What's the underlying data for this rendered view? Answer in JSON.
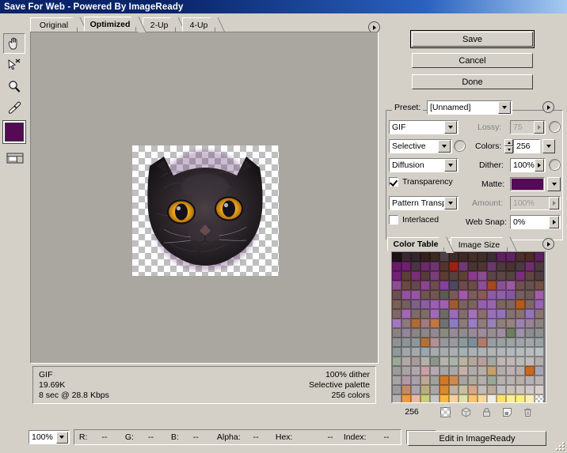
{
  "window": {
    "title": "Save For Web - Powered By ImageReady"
  },
  "tabs": [
    {
      "label": "Original",
      "active": false
    },
    {
      "label": "Optimized",
      "active": true
    },
    {
      "label": "2-Up",
      "active": false
    },
    {
      "label": "4-Up",
      "active": false
    }
  ],
  "toolbar": {
    "tools": [
      {
        "name": "hand-tool",
        "selected": true
      },
      {
        "name": "slice-select-tool",
        "selected": false
      },
      {
        "name": "zoom-tool",
        "selected": false
      },
      {
        "name": "eyedropper-tool",
        "selected": false
      }
    ],
    "eyedropper_color": "#550a55",
    "toggle_slices_name": "toggle-slices-visibility"
  },
  "buttons": {
    "save": "Save",
    "cancel": "Cancel",
    "done": "Done",
    "edit_in_imageready": "Edit in ImageReady"
  },
  "settings": {
    "preset_label": "Preset:",
    "preset_value": "[Unnamed]",
    "format_value": "GIF",
    "reduction_value": "Selective",
    "dither_algorithm_value": "Diffusion",
    "transparency_label": "Transparency",
    "transparency_checked": true,
    "transparency_dither_value": "Pattern Transp..",
    "interlaced_label": "Interlaced",
    "interlaced_checked": false,
    "lossy_label": "Lossy:",
    "lossy_value": "75",
    "lossy_enabled": false,
    "colors_label": "Colors:",
    "colors_value": "256",
    "dither_label": "Dither:",
    "dither_value": "100%",
    "matte_label": "Matte:",
    "matte_color": "#550a55",
    "amount_label": "Amount:",
    "amount_value": "100%",
    "amount_enabled": false,
    "web_snap_label": "Web Snap:",
    "web_snap_value": "0%"
  },
  "info": {
    "format": "GIF",
    "filesize": "19.69K",
    "download_time": "8 sec @ 28.8 Kbps",
    "dither": "100% dither",
    "palette": "Selective palette",
    "colors": "256 colors"
  },
  "color_table": {
    "tabs": [
      {
        "label": "Color Table",
        "active": true
      },
      {
        "label": "Image Size",
        "active": false
      }
    ],
    "count": "256",
    "buttons": [
      {
        "name": "map-to-transparent-button"
      },
      {
        "name": "web-shift-button"
      },
      {
        "name": "lock-color-button"
      },
      {
        "name": "new-color-button"
      },
      {
        "name": "delete-color-button"
      }
    ],
    "swatches": [
      "#1d1118",
      "#3a2830",
      "#33252c",
      "#36201c",
      "#3c2a23",
      "#4d4048",
      "#402a27",
      "#3e2a25",
      "#432e29",
      "#3f2d2a",
      "#3a2d35",
      "#602060",
      "#612262",
      "#4a2e2b",
      "#4c2a26",
      "#5e2060",
      "#6b1a6b",
      "#6f1f6f",
      "#4a3640",
      "#6a2b6a",
      "#6e3570",
      "#54342f",
      "#9a2410",
      "#6f3a70",
      "#4a342f",
      "#4f3731",
      "#6a3a6a",
      "#4b393d",
      "#483232",
      "#4c3a42",
      "#722c72",
      "#4e3a3e",
      "#741f74",
      "#5b3f36",
      "#7a2d7a",
      "#563c38",
      "#7a3e7c",
      "#5a3c33",
      "#57403d",
      "#5f4136",
      "#8a3a8c",
      "#8a4d8e",
      "#5a4444",
      "#5e4347",
      "#56423e",
      "#7a2e7a",
      "#624440",
      "#4d3c42",
      "#8e4d92",
      "#6a4a40",
      "#64484a",
      "#8b4591",
      "#6c4e4e",
      "#84409a",
      "#4d4a5e",
      "#6e4a4e",
      "#6c4c44",
      "#8d4e95",
      "#a14a1e",
      "#8b5293",
      "#9a5a9e",
      "#6e5050",
      "#655250",
      "#725044",
      "#6b5050",
      "#9352a1",
      "#9456a3",
      "#705452",
      "#74564e",
      "#5d5a52",
      "#7a5a58",
      "#a259ad",
      "#7d5c5c",
      "#8a5a56",
      "#8a5ca4",
      "#8e5fa8",
      "#8258a0",
      "#755e5c",
      "#6e5c5a",
      "#a05ea8",
      "#7a5e58",
      "#765e5e",
      "#80608a",
      "#8a5ea0",
      "#9a5fae",
      "#a05fb0",
      "#a05a32",
      "#7b6260",
      "#7e6260",
      "#9460ac",
      "#9a64b0",
      "#7c6462",
      "#7e6662",
      "#b35a1c",
      "#806666",
      "#9664b2",
      "#7e6866",
      "#a268b4",
      "#806a66",
      "#7e6c68",
      "#a16ab6",
      "#6e6a66",
      "#9c6cb8",
      "#816e6c",
      "#a470ba",
      "#8a6e6a",
      "#9b70b8",
      "#9372ba",
      "#847270",
      "#8a726e",
      "#9474bc",
      "#8a7472",
      "#a376bc",
      "#8a7a7c",
      "#b06a3a",
      "#a07a80",
      "#c07840",
      "#6f7270",
      "#8e7cc0",
      "#8a7a78",
      "#9a7ec4",
      "#8e7c7a",
      "#9a80b8",
      "#8e8078",
      "#97827e",
      "#9a82b0",
      "#9a8296",
      "#8e8280",
      "#8a8280",
      "#92849a",
      "#8a8482",
      "#8e8686",
      "#928890",
      "#8a8a80",
      "#968a94",
      "#8e8c8c",
      "#9a8a96",
      "#9e8c9c",
      "#968e90",
      "#a08ea0",
      "#6e7d5e",
      "#9e90a6",
      "#8a8e8e",
      "#8e9092",
      "#909292",
      "#8e9494",
      "#8e9696",
      "#b4703a",
      "#b09296",
      "#96989a",
      "#9a9a9c",
      "#8a9a9a",
      "#7d8e9a",
      "#b47a6a",
      "#9a9ea0",
      "#9aa0a2",
      "#9ea2a4",
      "#a0a4a6",
      "#a4a6a8",
      "#9aa4a6",
      "#8e9a98",
      "#a2a6a8",
      "#a4a8aa",
      "#9aa6b0",
      "#a6aaac",
      "#a8acae",
      "#aaaeb0",
      "#a4b0b2",
      "#acb0b2",
      "#aeb2b4",
      "#b0b4b6",
      "#b2b6b8",
      "#b4b8ba",
      "#b6babc",
      "#b8bcbe",
      "#babfc0",
      "#9aa89a",
      "#b2aaa8",
      "#a89a9a",
      "#b4b0aa",
      "#8a968a",
      "#b6b2ac",
      "#aab4a8",
      "#bcb2a0",
      "#b2a89a",
      "#b69e9a",
      "#a2a8a4",
      "#beb6b2",
      "#c0b8b4",
      "#b8bab6",
      "#c2bab8",
      "#b4aeac",
      "#9c9a9a",
      "#a8a4a4",
      "#b0a6b0",
      "#c6a0a6",
      "#b8a8b0",
      "#a6a6a8",
      "#aaa8aa",
      "#c6b0aa",
      "#b0aaac",
      "#b6aea8",
      "#c8a06a",
      "#b2acae",
      "#bcb0b2",
      "#b4aeb0",
      "#c86a20",
      "#a4a6b6",
      "#a8a4a2",
      "#b09aa8",
      "#a8a2a8",
      "#bca894",
      "#a0a09e",
      "#ce7a2a",
      "#cf8a52",
      "#a8a2a0",
      "#b0aa9a",
      "#b4aeaa",
      "#9aa69a",
      "#b6b0ae",
      "#b8b2b0",
      "#baaea8",
      "#b6b0b2",
      "#bab4b6",
      "#9c9a9c",
      "#c48a62",
      "#aaa4ac",
      "#b8ae80",
      "#aaa6a8",
      "#d88a32",
      "#c0b2a0",
      "#c4c0a0",
      "#d8a68a",
      "#c2bcb4",
      "#baa898",
      "#c0bec2",
      "#cac0ba",
      "#cec4be",
      "#d0c8c4",
      "#d6d0cc",
      "#b4b2b4",
      "#ee9a3a",
      "#eab8a0",
      "#c9ce78",
      "#c6c6c8",
      "#fab83a",
      "#f8cfa0",
      "#dce2a8",
      "#f9c46e",
      "#fad79a",
      "#eeeee6",
      "#ffe06a",
      "#fbee96",
      "#ffef78",
      "#feeeb8",
      "#ffffff"
    ]
  },
  "status": {
    "zoom_value": "100%",
    "r_label": "R:",
    "r_value": "--",
    "g_label": "G:",
    "g_value": "--",
    "b_label": "B:",
    "b_value": "--",
    "alpha_label": "Alpha:",
    "alpha_value": "--",
    "hex_label": "Hex:",
    "hex_value": "--",
    "index_label": "Index:",
    "index_value": "--",
    "preview_browser_name": "preview-in-browser-button"
  }
}
